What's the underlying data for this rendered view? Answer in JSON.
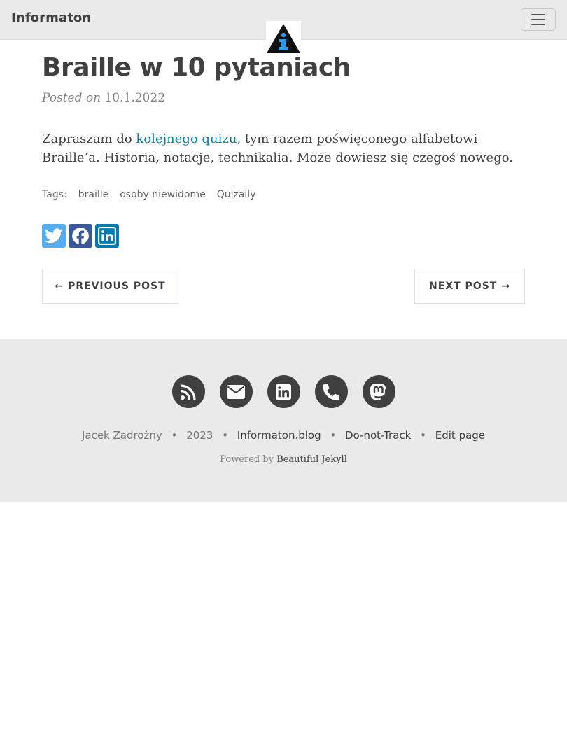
{
  "navbar": {
    "brand": "Informaton",
    "logo_icon": "info-triangle-icon",
    "menu_icon": "hamburger-icon"
  },
  "post": {
    "title": "Braille w 10 pytaniach",
    "posted_on": "Posted on",
    "date": "10.1.2022",
    "body_before": "Zapraszam do ",
    "body_link": "kolejnego quizu",
    "body_after": ", tym razem poświęconego alfabetowi Braille’a. Historia, notacje, technikalia. Może dowiesz się czegoś nowego.",
    "tags_label": "Tags:",
    "tags": [
      "braille",
      "osoby niewidome",
      "Quizally"
    ],
    "share": [
      "twitter-icon",
      "facebook-icon",
      "linkedin-icon"
    ],
    "prev_label": "← Previous Post",
    "next_label": "Next Post →"
  },
  "footer": {
    "icons": [
      "rss-icon",
      "envelope-icon",
      "linkedin-icon",
      "phone-icon",
      "mastodon-icon"
    ],
    "author": "Jacek Zadrożny",
    "year": "2023",
    "site": "Informaton.blog",
    "dnt": "Do-not-Track",
    "edit": "Edit page",
    "powered_by": "Powered by",
    "engine": "Beautiful Jekyll",
    "separator": "•"
  },
  "colors": {
    "nav_bg": "#eaeaea",
    "text": "#404040",
    "link": "#0085a1",
    "twitter": "#55acee",
    "facebook": "#3b5998",
    "linkedin": "#007bb5"
  }
}
